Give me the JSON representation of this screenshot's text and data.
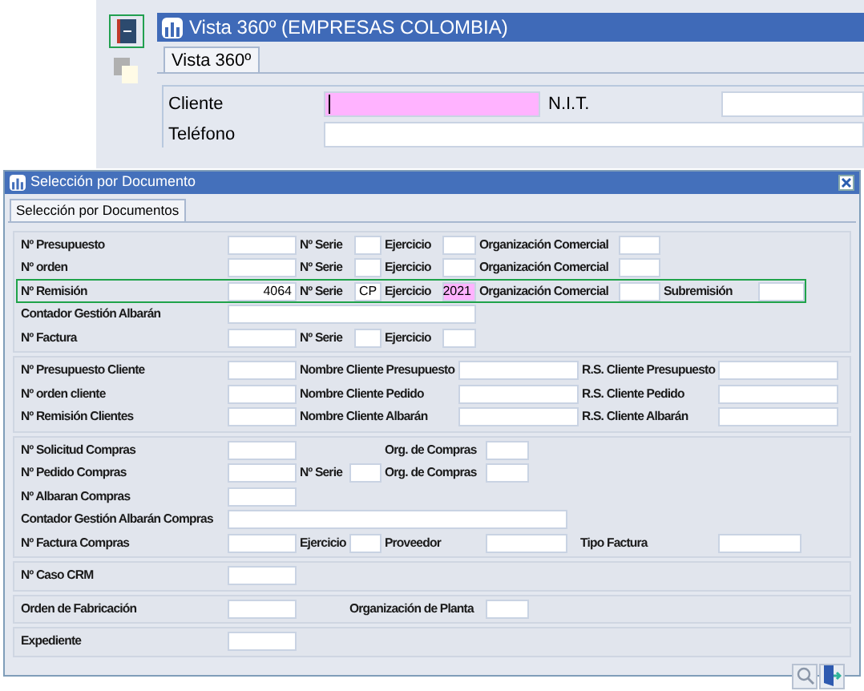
{
  "back_window": {
    "title": "Vista 360º (EMPRESAS COLOMBIA)",
    "tabs": [
      {
        "label": "Vista 360º",
        "selected": true
      }
    ],
    "rows": [
      {
        "label": "Cliente",
        "focused": true,
        "label_2": "N.I.T."
      },
      {
        "label": "Teléfono",
        "focused": false
      }
    ]
  },
  "dialog": {
    "title": "Selección por Documento",
    "tabs": [
      {
        "label": "Selección por Documentos",
        "selected": true
      }
    ],
    "sections": [
      {
        "rows": [
          {
            "selected": false,
            "cells": [
              {
                "kind": "label",
                "text": "Nº Presupuesto"
              },
              {
                "kind": "field",
                "focused": false
              },
              {
                "kind": "label",
                "text": "Nº Serie"
              },
              {
                "kind": "field",
                "focused": false
              },
              {
                "kind": "label",
                "text": "Ejercicio"
              },
              {
                "kind": "field",
                "focused": false
              },
              {
                "kind": "label",
                "text": "Organización Comercial"
              },
              {
                "kind": "field",
                "focused": false
              }
            ]
          },
          {
            "selected": false,
            "cells": [
              {
                "kind": "label",
                "text": "Nº orden"
              },
              {
                "kind": "field",
                "focused": false
              },
              {
                "kind": "label",
                "text": "Nº Serie"
              },
              {
                "kind": "field",
                "focused": false
              },
              {
                "kind": "label",
                "text": "Ejercicio"
              },
              {
                "kind": "field",
                "focused": false
              },
              {
                "kind": "label",
                "text": "Organización Comercial"
              },
              {
                "kind": "field",
                "focused": false
              }
            ]
          },
          {
            "selected": true,
            "cells": [
              {
                "kind": "label",
                "text": "Nº Remisión"
              },
              {
                "kind": "field",
                "value": "4064",
                "focused": false
              },
              {
                "kind": "label",
                "text": "Nº Serie"
              },
              {
                "kind": "field",
                "value": "CP",
                "focused": false
              },
              {
                "kind": "label",
                "text": "Ejercicio"
              },
              {
                "kind": "field",
                "value": "2021",
                "focused": true
              },
              {
                "kind": "label",
                "text": "Organización Comercial"
              },
              {
                "kind": "field",
                "focused": false
              },
              {
                "kind": "label",
                "text": "Subremisión"
              },
              {
                "kind": "field",
                "focused": false
              }
            ]
          },
          {
            "selected": false,
            "cells": [
              {
                "kind": "label",
                "text": "Contador Gestión Albarán"
              },
              {
                "kind": "field",
                "focused": false
              }
            ]
          },
          {
            "selected": false,
            "cells": [
              {
                "kind": "label",
                "text": "Nº Factura"
              },
              {
                "kind": "field",
                "focused": false
              },
              {
                "kind": "label",
                "text": "Nº Serie"
              },
              {
                "kind": "field",
                "focused": false
              },
              {
                "kind": "label",
                "text": "Ejercicio"
              },
              {
                "kind": "field",
                "focused": false
              }
            ]
          }
        ]
      },
      {
        "rows": [
          {
            "selected": false,
            "cells": [
              {
                "kind": "label",
                "text": "Nº Presupuesto Cliente"
              },
              {
                "kind": "field",
                "focused": false
              },
              {
                "kind": "label",
                "text": "Nombre Cliente Presupuesto"
              },
              {
                "kind": "field",
                "focused": false
              },
              {
                "kind": "label",
                "text": "R.S. Cliente Presupuesto"
              },
              {
                "kind": "field",
                "focused": false
              }
            ]
          },
          {
            "selected": false,
            "cells": [
              {
                "kind": "label",
                "text": "Nº orden cliente"
              },
              {
                "kind": "field",
                "focused": false
              },
              {
                "kind": "label",
                "text": "Nombre Cliente Pedido"
              },
              {
                "kind": "field",
                "focused": false
              },
              {
                "kind": "label",
                "text": "R.S. Cliente Pedido"
              },
              {
                "kind": "field",
                "focused": false
              }
            ]
          },
          {
            "selected": false,
            "cells": [
              {
                "kind": "label",
                "text": "Nº Remisión Clientes"
              },
              {
                "kind": "field",
                "focused": false
              },
              {
                "kind": "label",
                "text": "Nombre Cliente Albarán"
              },
              {
                "kind": "field",
                "focused": false
              },
              {
                "kind": "label",
                "text": "R.S. Cliente Albarán"
              },
              {
                "kind": "field",
                "focused": false
              }
            ]
          }
        ]
      },
      {
        "rows": [
          {
            "selected": false,
            "cells": [
              {
                "kind": "label",
                "text": "Nº Solicitud Compras"
              },
              {
                "kind": "field",
                "focused": false
              },
              {
                "kind": "spacer"
              },
              {
                "kind": "spacer"
              },
              {
                "kind": "label",
                "text": "Org. de Compras"
              },
              {
                "kind": "field",
                "focused": false
              }
            ]
          },
          {
            "selected": false,
            "cells": [
              {
                "kind": "label",
                "text": "Nº Pedido Compras"
              },
              {
                "kind": "field",
                "focused": false
              },
              {
                "kind": "label",
                "text": "Nº Serie"
              },
              {
                "kind": "field",
                "focused": false
              },
              {
                "kind": "label",
                "text": "Org. de Compras"
              },
              {
                "kind": "field",
                "focused": false
              }
            ]
          },
          {
            "selected": false,
            "cells": [
              {
                "kind": "label",
                "text": "Nº Albaran Compras"
              },
              {
                "kind": "field",
                "focused": false
              }
            ]
          },
          {
            "selected": false,
            "cells": [
              {
                "kind": "label",
                "text": "Contador Gestión Albarán Compras"
              },
              {
                "kind": "field",
                "focused": false
              }
            ]
          },
          {
            "selected": false,
            "cells": [
              {
                "kind": "label",
                "text": "Nº Factura Compras"
              },
              {
                "kind": "field",
                "focused": false
              },
              {
                "kind": "label",
                "text": "Ejercicio"
              },
              {
                "kind": "field",
                "focused": false
              },
              {
                "kind": "label",
                "text": "Proveedor"
              },
              {
                "kind": "field",
                "focused": false
              },
              {
                "kind": "label",
                "text": "Tipo Factura"
              },
              {
                "kind": "field",
                "focused": false
              }
            ]
          }
        ]
      },
      {
        "rows": [
          {
            "selected": false,
            "cells": [
              {
                "kind": "label",
                "text": "Nº Caso CRM"
              },
              {
                "kind": "field",
                "focused": false
              }
            ]
          }
        ]
      },
      {
        "rows": [
          {
            "selected": false,
            "cells": [
              {
                "kind": "label",
                "text": "Orden de Fabricación"
              },
              {
                "kind": "field",
                "focused": false
              },
              {
                "kind": "label",
                "text": "Organización de Planta"
              },
              {
                "kind": "field",
                "focused": false
              }
            ]
          }
        ]
      },
      {
        "rows": [
          {
            "selected": false,
            "cells": [
              {
                "kind": "label",
                "text": "Expediente"
              },
              {
                "kind": "field",
                "focused": false
              }
            ]
          }
        ]
      }
    ]
  }
}
